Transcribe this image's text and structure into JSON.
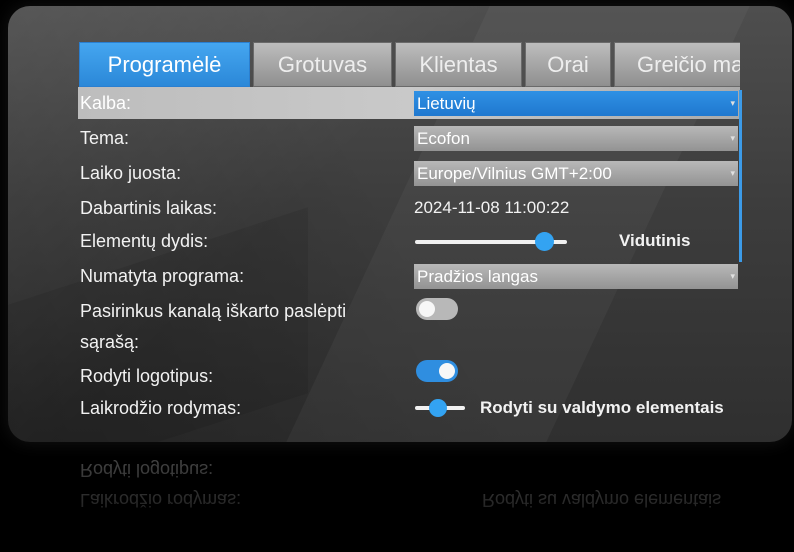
{
  "tabs": [
    {
      "label": "Programėlė",
      "active": true
    },
    {
      "label": "Grotuvas",
      "active": false
    },
    {
      "label": "Klientas",
      "active": false
    },
    {
      "label": "Orai",
      "active": false
    },
    {
      "label": "Greičio ma",
      "active": false
    }
  ],
  "settings": {
    "language": {
      "label": "Kalba:",
      "value": "Lietuvių"
    },
    "theme": {
      "label": "Tema:",
      "value": "Ecofon"
    },
    "timezone": {
      "label": "Laiko juosta:",
      "value": "Europe/Vilnius GMT+2:00"
    },
    "current_time": {
      "label": "Dabartinis laikas:",
      "value": "2024-11-08 11:00:22"
    },
    "element_size": {
      "label": "Elementų dydis:",
      "value": "Vidutinis",
      "slider_level": 0.85
    },
    "default_program": {
      "label": "Numatyta programa:",
      "value": "Pradžios langas"
    },
    "hide_list": {
      "label_line1": "Pasirinkus kanalą iškarto paslėpti",
      "label_line2": "sąrašą:",
      "enabled": false
    },
    "show_logos": {
      "label": "Rodyti logotipus:",
      "enabled": true
    },
    "clock_display": {
      "label": "Laikrodžio rodymas:",
      "value": "Rodyti su valdymo elementais"
    }
  },
  "colors": {
    "accent": "#2f8ee0",
    "panel_bg": "#3f3f3f",
    "dropdown_bg": "#a8a8a8"
  },
  "icons": {
    "dropdown_arrow": "chevron-down-icon"
  }
}
